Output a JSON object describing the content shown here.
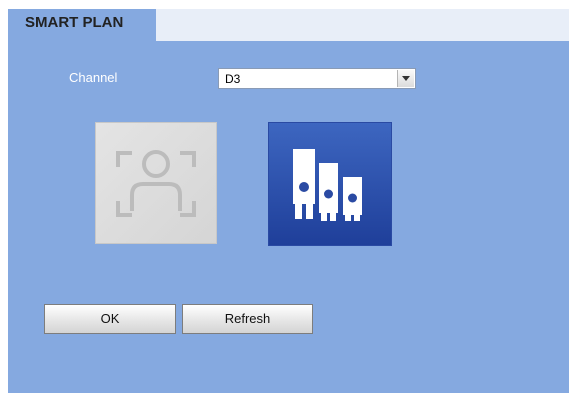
{
  "window": {
    "active_tab": "SMART PLAN"
  },
  "form": {
    "channel_label": "Channel",
    "channel_value": "D3"
  },
  "tiles": [
    {
      "icon": "face-detection-icon",
      "state": "disabled"
    },
    {
      "icon": "people-counting-icon",
      "state": "selected"
    }
  ],
  "buttons": {
    "ok_label": "OK",
    "refresh_label": "Refresh"
  },
  "colors": {
    "panel": "#85a9e0",
    "tab_strip": "#e8eef8",
    "selected_tile": "#2a4fae",
    "disabled_tile": "#dcdcdc"
  }
}
